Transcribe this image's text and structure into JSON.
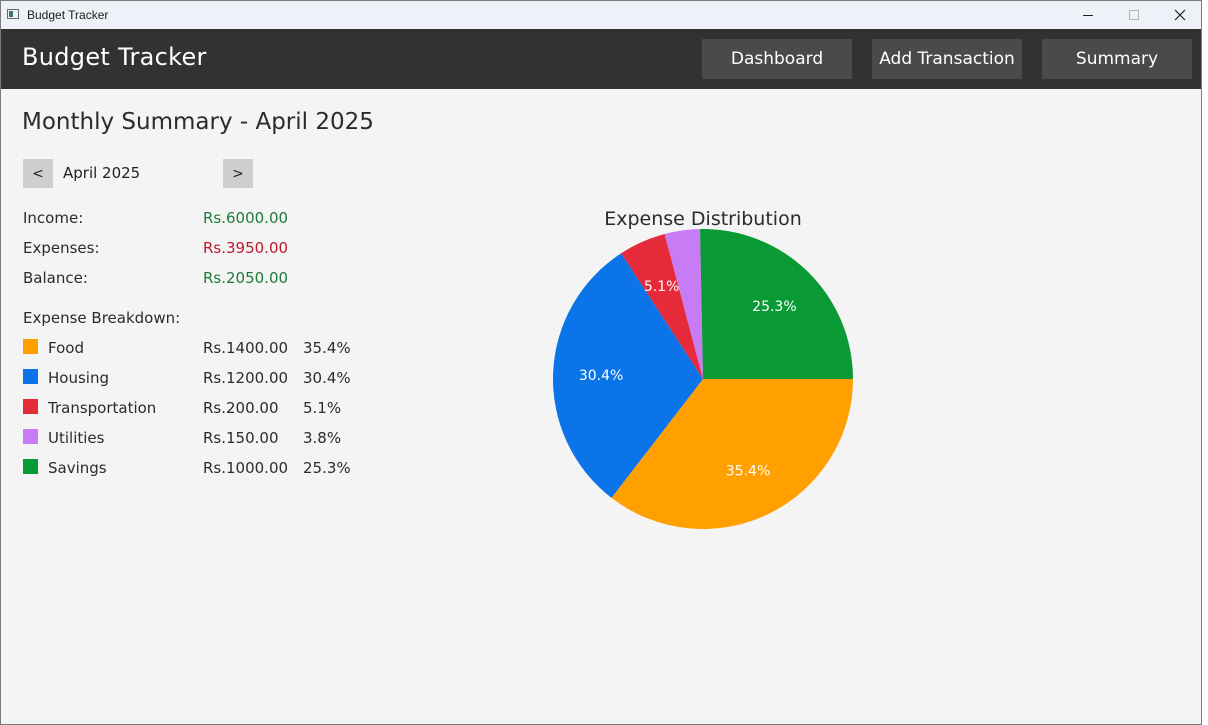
{
  "window": {
    "title": "Budget Tracker"
  },
  "header": {
    "app_title": "Budget Tracker",
    "nav": {
      "dashboard": "Dashboard",
      "add_transaction": "Add Transaction",
      "summary": "Summary"
    }
  },
  "summary": {
    "title": "Monthly Summary - April 2025",
    "prev_label": "<",
    "next_label": ">",
    "month": "April 2025",
    "rows": [
      {
        "label": "Income:",
        "value": "Rs.6000.00",
        "color": "#1e7a3a"
      },
      {
        "label": "Expenses:",
        "value": "Rs.3950.00",
        "color": "#c0182c"
      },
      {
        "label": "Balance:",
        "value": "Rs.2050.00",
        "color": "#1e7a3a"
      }
    ],
    "breakdown_title": "Expense Breakdown:",
    "categories": [
      {
        "name": "Food",
        "amount": "Rs.1400.00",
        "percent": "35.4%",
        "color": "#ffa000"
      },
      {
        "name": "Housing",
        "amount": "Rs.1200.00",
        "percent": "30.4%",
        "color": "#0a74e8"
      },
      {
        "name": "Transportation",
        "amount": "Rs.200.00",
        "percent": "5.1%",
        "color": "#e52a3a"
      },
      {
        "name": "Utilities",
        "amount": "Rs.150.00",
        "percent": "3.8%",
        "color": "#c77cf5"
      },
      {
        "name": "Savings",
        "amount": "Rs.1000.00",
        "percent": "25.3%",
        "color": "#0a9a35"
      }
    ]
  },
  "chart_data": {
    "type": "pie",
    "title": "Expense Distribution",
    "categories": [
      "Food",
      "Housing",
      "Transportation",
      "Utilities",
      "Savings"
    ],
    "values": [
      1400,
      1200,
      200,
      150,
      1000
    ],
    "labels": [
      "35.4%",
      "30.4%",
      "5.1%",
      "",
      "25.3%"
    ],
    "colors": [
      "#ffa000",
      "#0a74e8",
      "#e52a3a",
      "#c77cf5",
      "#0a9a35"
    ],
    "start_angle_deg": 0,
    "direction": "clockwise",
    "legend": "none"
  }
}
